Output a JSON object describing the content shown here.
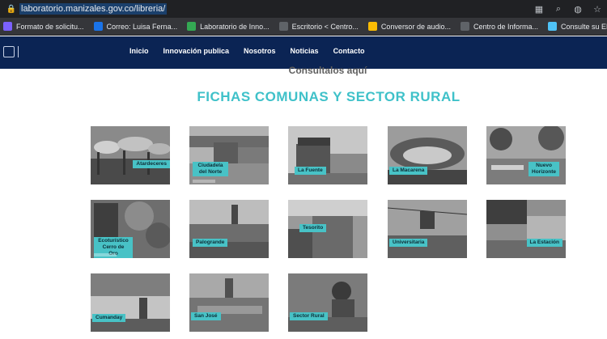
{
  "browser": {
    "url": "laboratorio.manizales.gov.co/libreria/",
    "bookmarks": [
      {
        "label": "Formato de solicitu...",
        "color": "#7b61ff"
      },
      {
        "label": "Correo: Luisa Ferna...",
        "color": "#1a73e8"
      },
      {
        "label": "Laboratorio de Inno...",
        "color": "#34a853"
      },
      {
        "label": "Escritorio < Centro...",
        "color": "#5f6368"
      },
      {
        "label": "Conversor de audio...",
        "color": "#fbbc04"
      },
      {
        "label": "Centro de Informa...",
        "color": "#5f6368"
      },
      {
        "label": "Consulte su EPS",
        "color": "#4fc3f7"
      }
    ]
  },
  "site": {
    "nav": [
      "Inicio",
      "Innovación publica",
      "Nosotros",
      "Noticias",
      "Contacto"
    ],
    "subtitle": "Consultalos aquí",
    "title": "FICHAS COMUNAS Y SECTOR RURAL"
  },
  "cards": [
    {
      "label": "Atardeceres"
    },
    {
      "label": "Ciudadela del Norte"
    },
    {
      "label": "La Fuente"
    },
    {
      "label": "La Macarena"
    },
    {
      "label": "Nuevo Horizonte"
    },
    {
      "label": "Ecoturístico Cerro de Oro"
    },
    {
      "label": "Palogrande"
    },
    {
      "label": "Tesorito"
    },
    {
      "label": "Universitaria"
    },
    {
      "label": "La Estación"
    },
    {
      "label": "Cumanday"
    },
    {
      "label": "San José"
    },
    {
      "label": "Sector Rural"
    }
  ]
}
